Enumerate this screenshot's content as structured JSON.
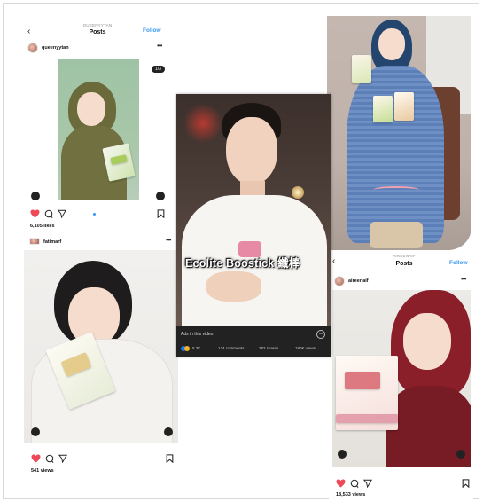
{
  "card1": {
    "header_sub": "QUEENYYTAN",
    "header_title": "Posts",
    "follow": "Follow",
    "username": "queenyytan",
    "counter": "1/3",
    "likes": "6,105 likes"
  },
  "card2": {
    "username": "fatimarf",
    "views": "541 views"
  },
  "card3": {
    "caption": "Ecolite Boostick 纖棒",
    "ads_label": "Ads in this video",
    "reactions": "5.3K",
    "comments": "134 comments",
    "shares": "282 shares",
    "views": "180K views"
  },
  "card5": {
    "header_sub": "AIREENAIF",
    "header_title": "Posts",
    "follow": "Follow",
    "username": "aireenaif",
    "views": "18,533 views"
  },
  "colors": {
    "instagram_blue": "#3897f0",
    "like_red": "#ed4956"
  }
}
